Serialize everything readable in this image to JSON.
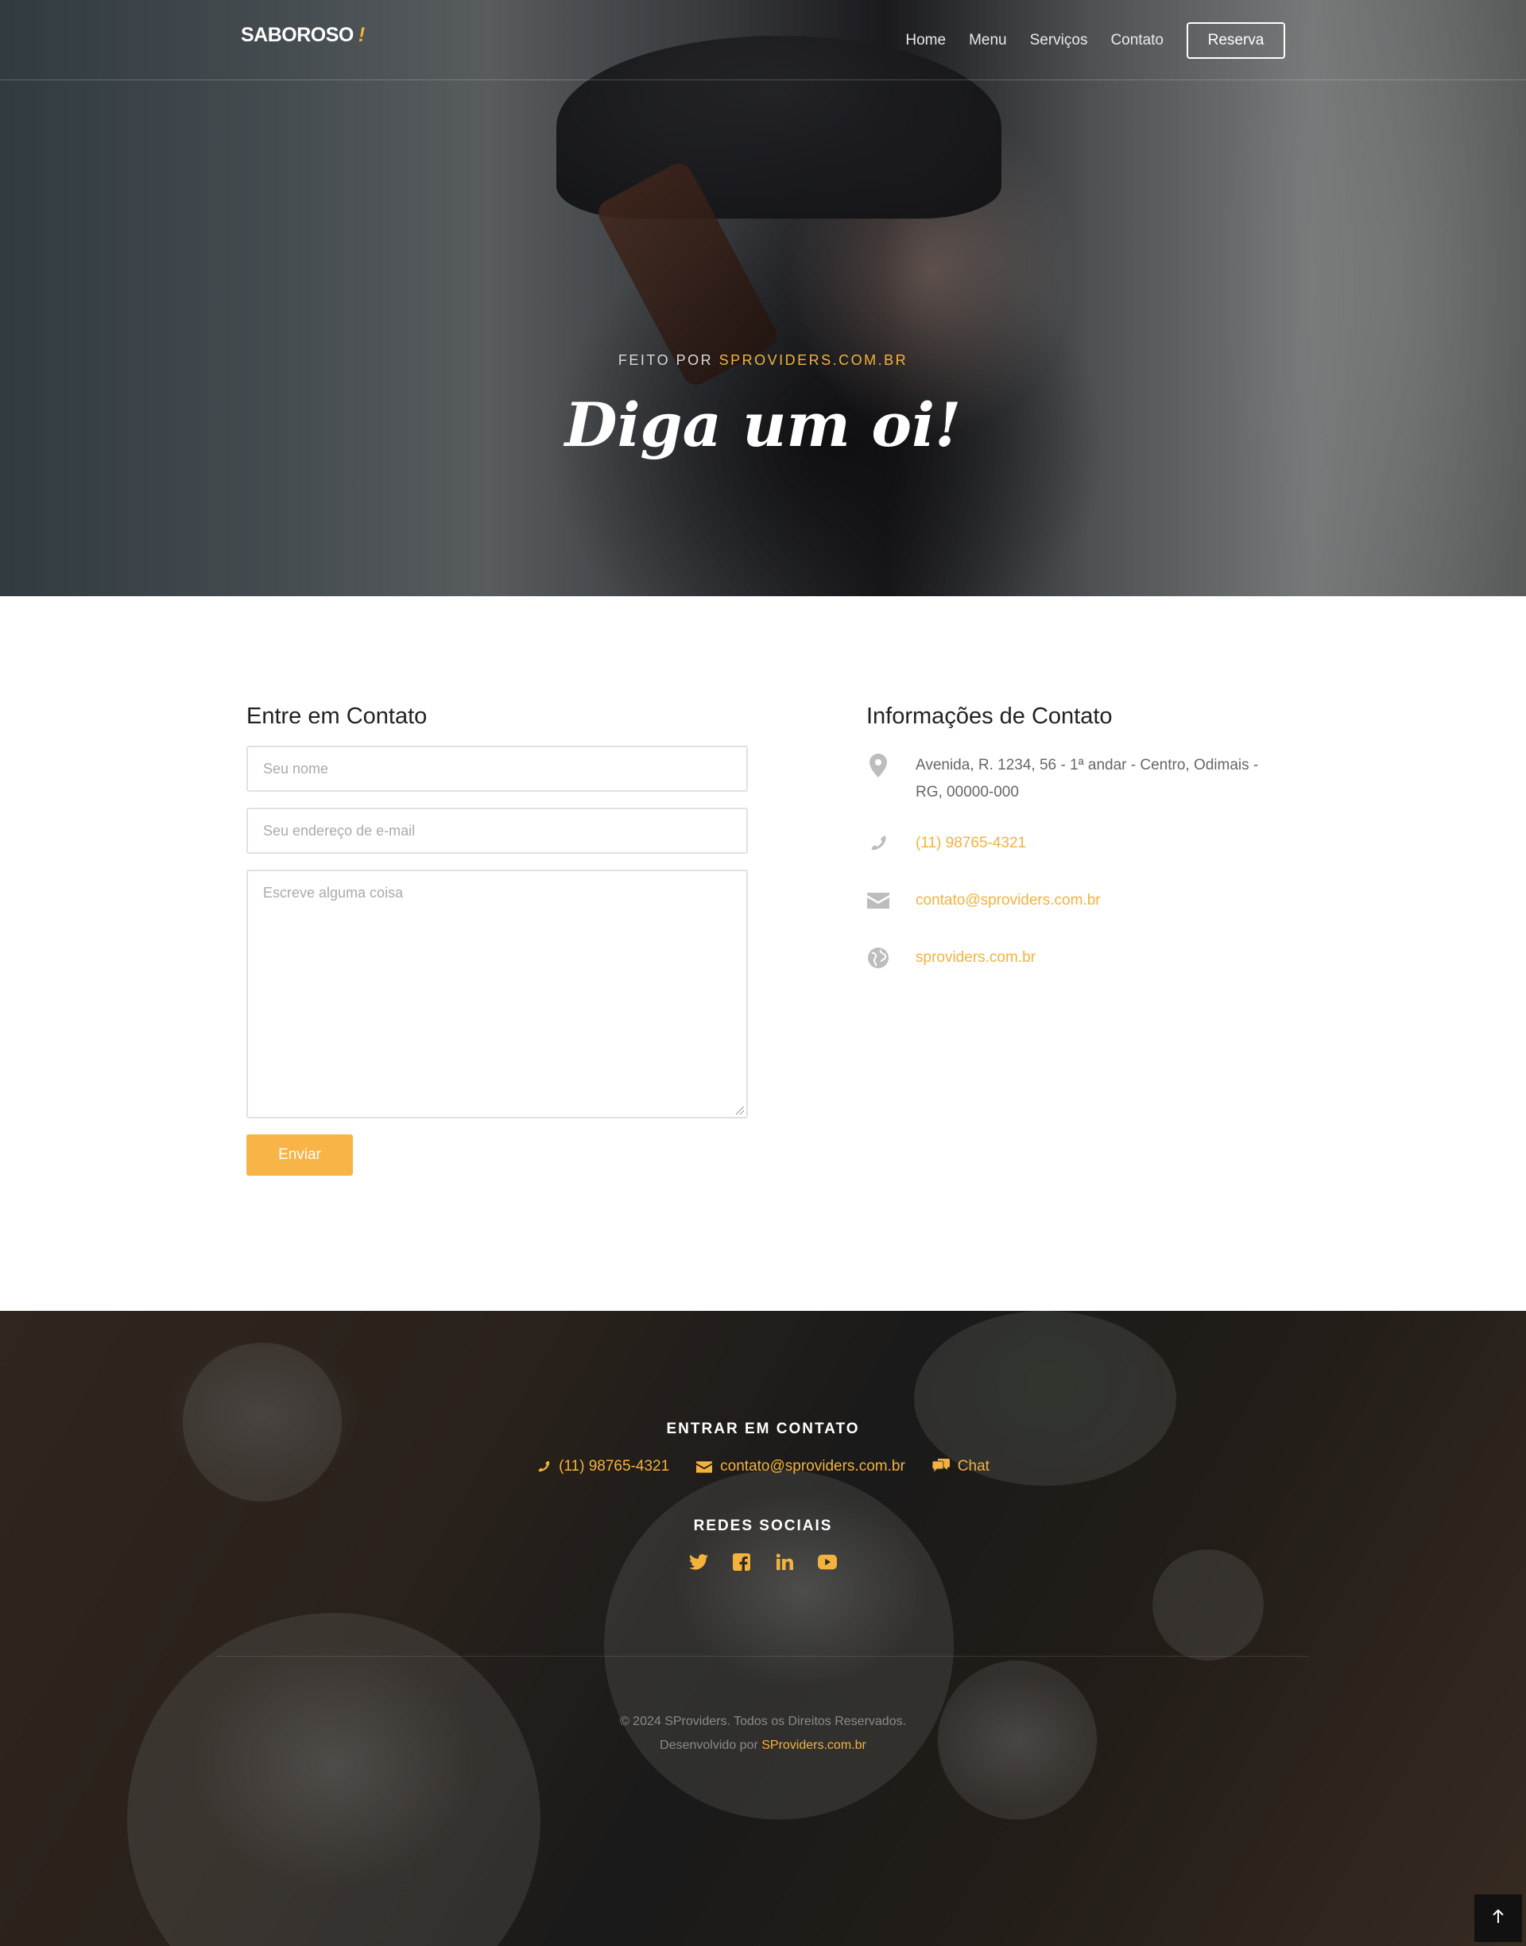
{
  "navbar": {
    "brand": "SABOROSO",
    "brand_mark": "!",
    "links": [
      "Home",
      "Menu",
      "Serviços",
      "Contato"
    ],
    "reserve_label": "Reserva"
  },
  "hero": {
    "subtitle_prefix": "FEITO POR ",
    "subtitle_highlight": "SPROVIDERS.COM.BR",
    "title": "Diga um oi!"
  },
  "contact_form": {
    "title": "Entre em Contato",
    "name_placeholder": "Seu nome",
    "email_placeholder": "Seu endereço de e-mail",
    "message_placeholder": "Escreve alguma coisa",
    "submit_label": "Enviar"
  },
  "contact_info": {
    "title": "Informações de Contato",
    "items": [
      {
        "icon": "map-marker-icon",
        "text": "Avenida, R. 1234, 56 - 1ª andar - Centro, Odimais - RG, 00000-000"
      },
      {
        "icon": "phone-icon",
        "text": "(11) 98765-4321"
      },
      {
        "icon": "envelope-icon",
        "text": "contato@sproviders.com.br"
      },
      {
        "icon": "globe-icon",
        "text": "sproviders.com.br"
      }
    ]
  },
  "footer": {
    "contact_title": "ENTRAR EM CONTATO",
    "phone": "(11) 98765-4321",
    "email": "contato@sproviders.com.br",
    "chat": "Chat",
    "social_title": "REDES SOCIAIS",
    "social_icons": [
      "twitter-icon",
      "facebook-icon",
      "linkedin-icon",
      "youtube-icon"
    ],
    "copyright": "© 2024 SProviders. Todos os Direitos Reservados.",
    "developed_prefix": "Desenvolvido por ",
    "developed_link": "SProviders.com.br"
  },
  "colors": {
    "accent": "#f4b23d",
    "button": "#f8b446",
    "text_muted": "#666666"
  }
}
